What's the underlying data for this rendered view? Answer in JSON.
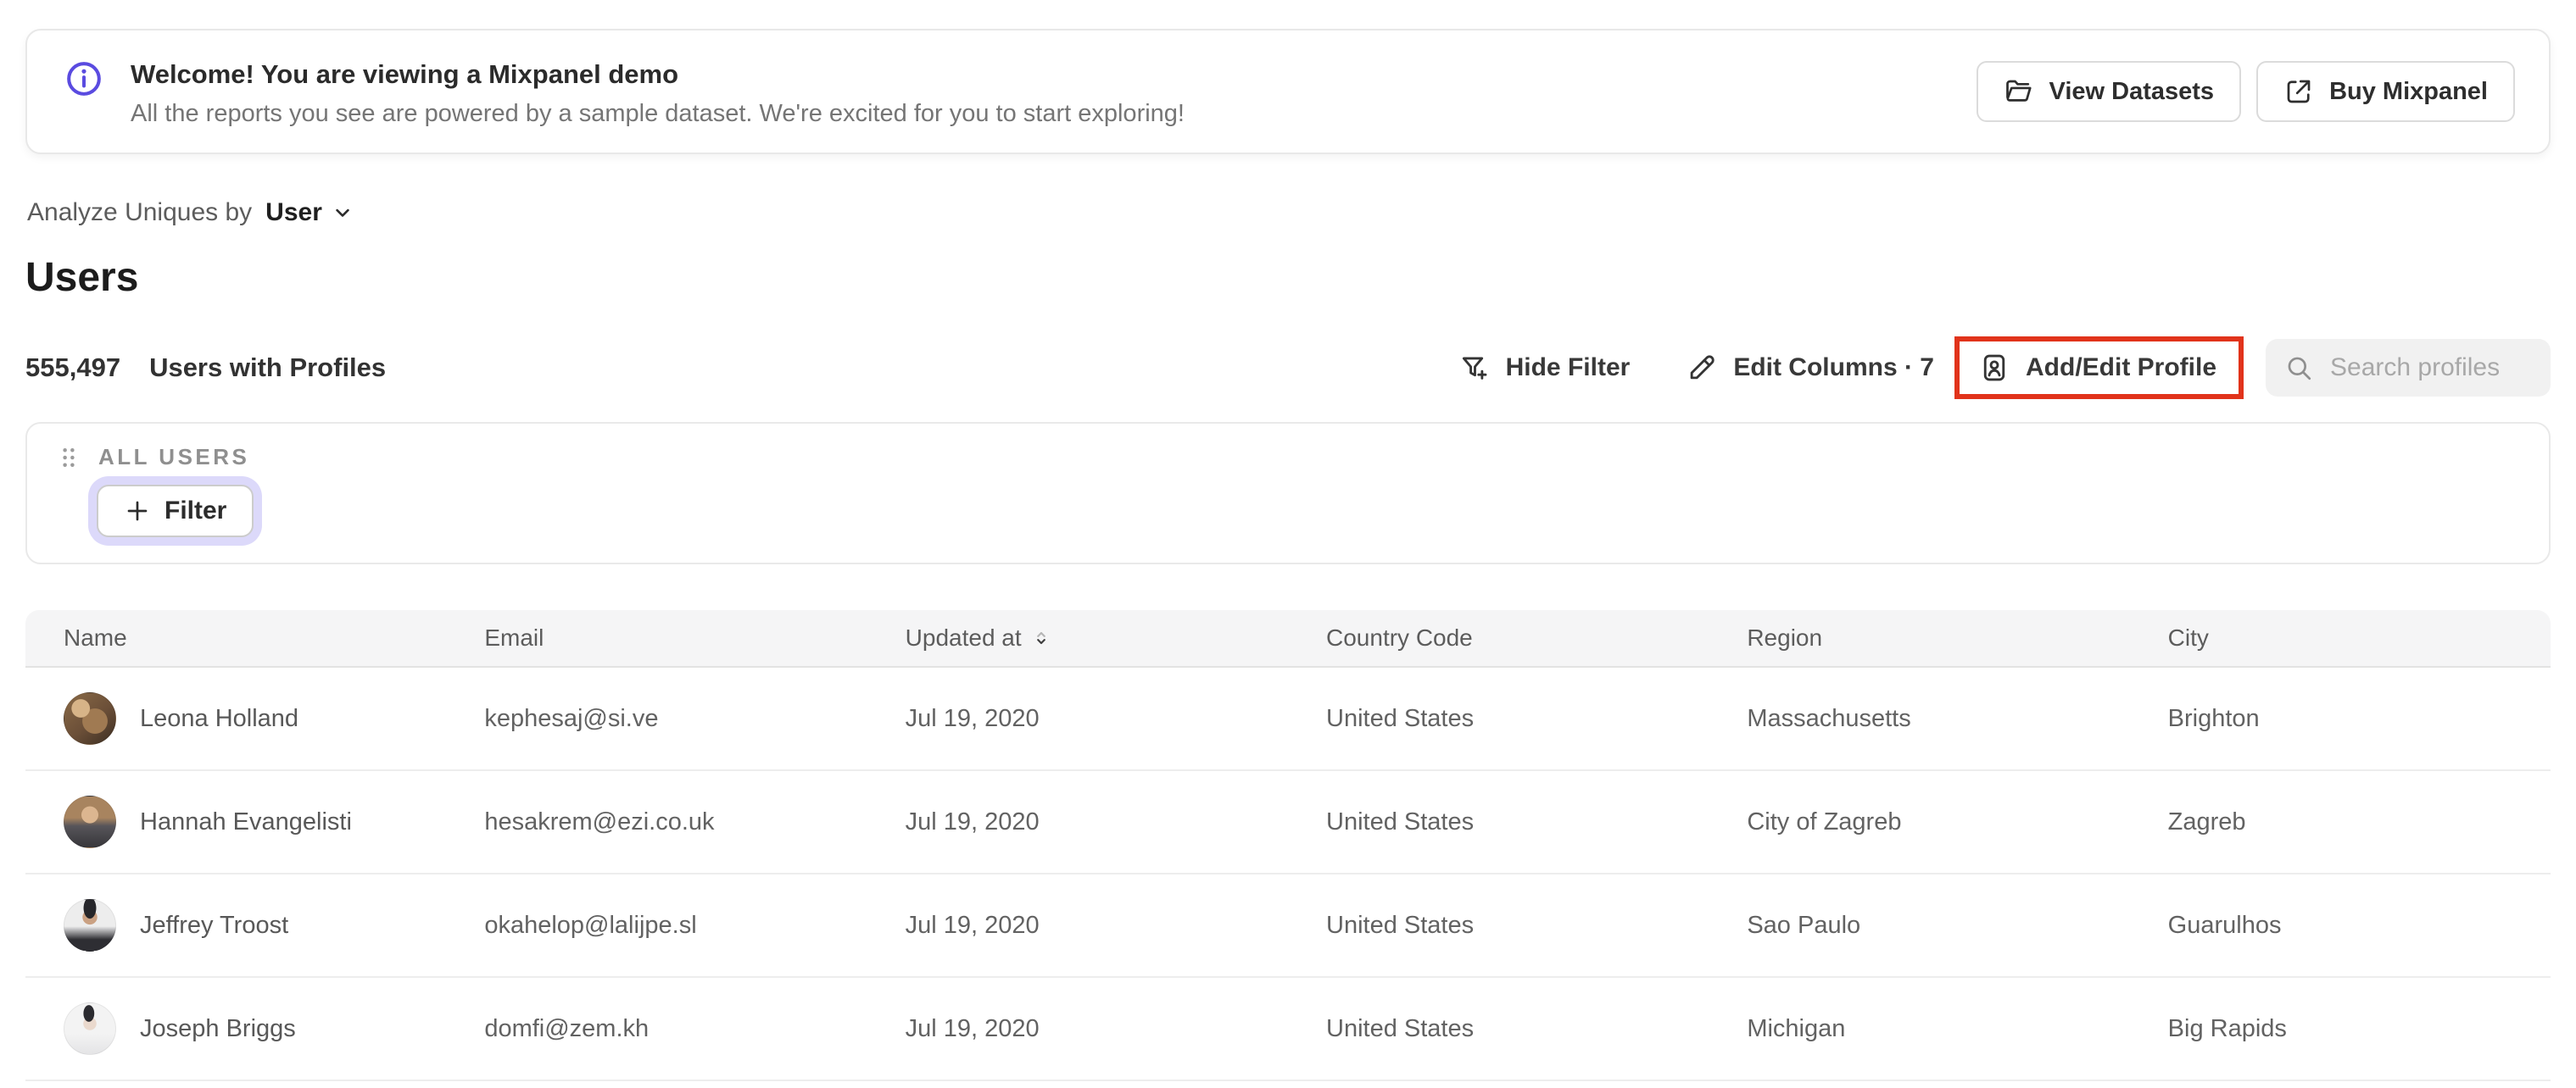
{
  "banner": {
    "title": "Welcome! You are viewing a Mixpanel demo",
    "subtitle": "All the reports you see are powered by a sample dataset. We're excited for you to start exploring!",
    "view_datasets_label": "View Datasets",
    "buy_mixpanel_label": "Buy Mixpanel"
  },
  "controls": {
    "analyze_label": "Analyze Uniques by",
    "analyze_value": "User"
  },
  "page_title": "Users",
  "summary": {
    "count": "555,497",
    "label": "Users with Profiles"
  },
  "toolbar": {
    "hide_filter_label": "Hide Filter",
    "edit_columns_label": "Edit Columns · 7",
    "add_edit_profile_label": "Add/Edit Profile",
    "search_placeholder": "Search profiles"
  },
  "filter_panel": {
    "group_label": "ALL USERS",
    "add_filter_label": "Filter"
  },
  "table": {
    "columns": [
      "Name",
      "Email",
      "Updated at",
      "Country Code",
      "Region",
      "City"
    ],
    "rows": [
      {
        "name": "Leona Holland",
        "email": "kephesaj@si.ve",
        "updated_at": "Jul 19, 2020",
        "country": "United States",
        "region": "Massachusetts",
        "city": "Brighton"
      },
      {
        "name": "Hannah Evangelisti",
        "email": "hesakrem@ezi.co.uk",
        "updated_at": "Jul 19, 2020",
        "country": "United States",
        "region": "City of Zagreb",
        "city": "Zagreb"
      },
      {
        "name": "Jeffrey Troost",
        "email": "okahelop@lalijpe.sl",
        "updated_at": "Jul 19, 2020",
        "country": "United States",
        "region": "Sao Paulo",
        "city": "Guarulhos"
      },
      {
        "name": "Joseph Briggs",
        "email": "domfi@zem.kh",
        "updated_at": "Jul 19, 2020",
        "country": "United States",
        "region": "Michigan",
        "city": "Big Rapids"
      }
    ]
  },
  "colors": {
    "annotation_red": "#e1331b",
    "accent_purple": "#5a4be0",
    "filter_ring": "#dcd9fa"
  }
}
